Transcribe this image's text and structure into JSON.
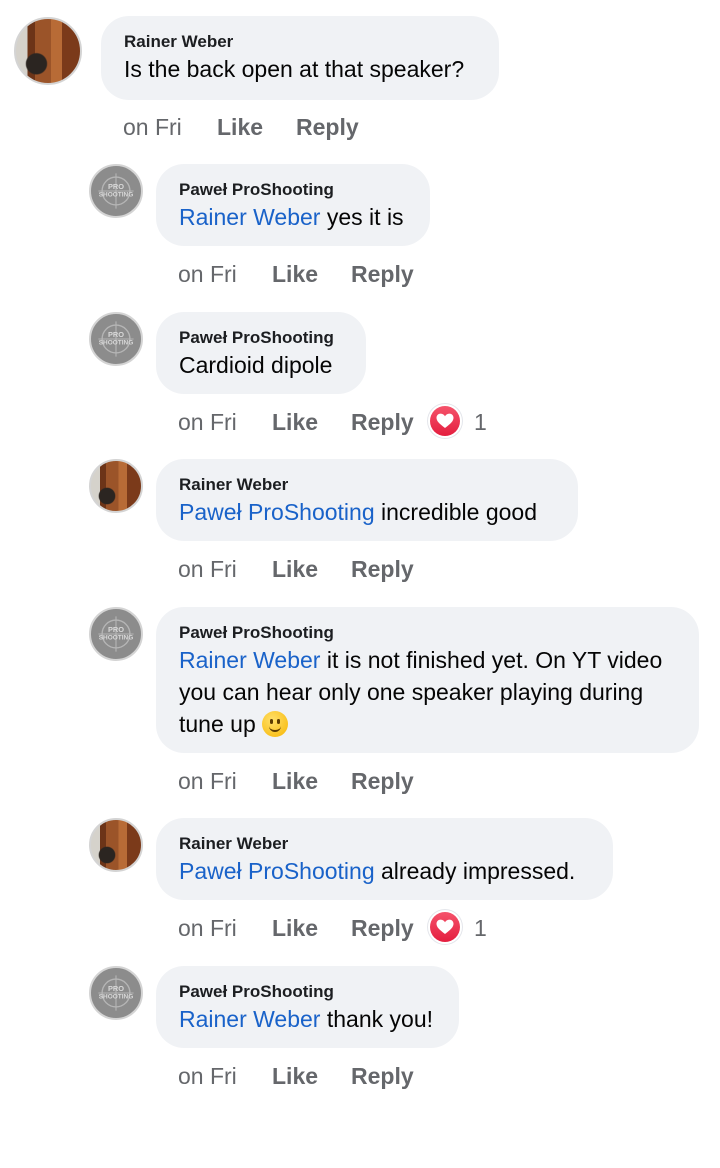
{
  "comments": [
    {
      "author": "Rainer Weber",
      "mention": "",
      "text": "Is the back open at that speaker?",
      "time": "on Fri",
      "like": "Like",
      "reply": "Reply",
      "reactions": ""
    },
    {
      "author": "Paweł ProShooting",
      "mention": "Rainer Weber",
      "text": " yes it is",
      "time": "on Fri",
      "like": "Like",
      "reply": "Reply",
      "reactions": ""
    },
    {
      "author": "Paweł ProShooting",
      "mention": "",
      "text": "Cardioid dipole",
      "time": "on Fri",
      "like": "Like",
      "reply": "Reply",
      "reactions": "1"
    },
    {
      "author": "Rainer Weber",
      "mention": "Paweł ProShooting",
      "text": " incredible good",
      "time": "on Fri",
      "like": "Like",
      "reply": "Reply",
      "reactions": ""
    },
    {
      "author": "Paweł ProShooting",
      "mention": "Rainer Weber",
      "text": " it is not finished yet. On YT video you can hear only one speaker playing during tune up ",
      "time": "on Fri",
      "like": "Like",
      "reply": "Reply",
      "reactions": ""
    },
    {
      "author": "Rainer Weber",
      "mention": "Paweł ProShooting",
      "text": " already impressed.",
      "time": "on Fri",
      "like": "Like",
      "reply": "Reply",
      "reactions": "1"
    },
    {
      "author": "Paweł ProShooting",
      "mention": "Rainer Weber",
      "text": " thank you!",
      "time": "on Fri",
      "like": "Like",
      "reply": "Reply",
      "reactions": ""
    }
  ],
  "avatar_logo_text": [
    "PRO",
    "SHOOTING"
  ],
  "colors": {
    "bubble": "#f0f2f5",
    "mention": "#1962c9",
    "meta": "#65676b",
    "reaction": "#e41e3f"
  },
  "icons": {
    "reaction": "heart-icon",
    "emoji": "smiling-face-icon"
  }
}
